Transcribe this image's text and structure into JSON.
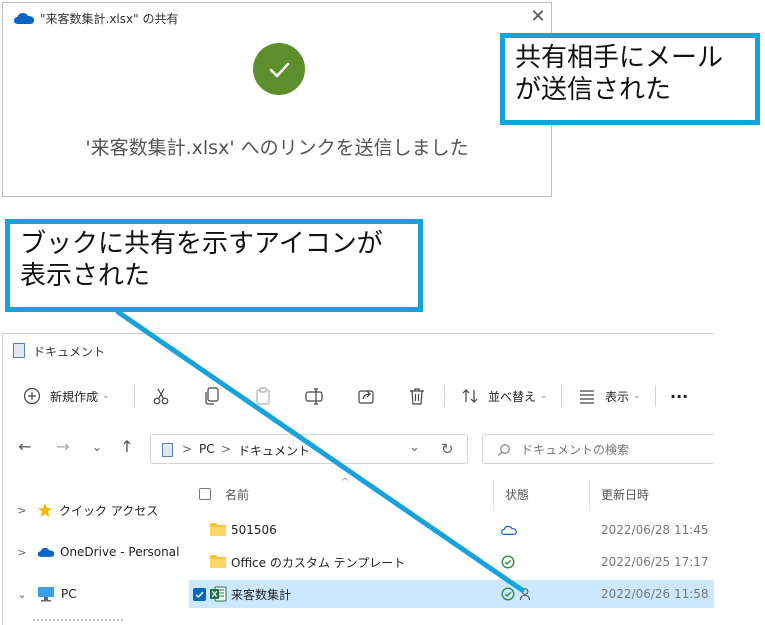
{
  "dialog": {
    "title": "\"来客数集計.xlsx\" の共有",
    "close_glyph": "✕",
    "message": "'来客数集計.xlsx' へのリンクを送信しました"
  },
  "callouts": {
    "top": "共有相手にメール\nが送信された",
    "middle": "ブックに共有を示すアイコンが\n表示された"
  },
  "explorer": {
    "title": "ドキュメント",
    "toolbar": {
      "new_label": "新規作成",
      "sort_label": "並べ替え",
      "view_label": "表示",
      "more_glyph": "···"
    },
    "nav": {
      "back": "←",
      "forward": "→",
      "recent": "⌄",
      "up": "↑",
      "refresh": "↻"
    },
    "address": {
      "pc": "PC",
      "sep": ">",
      "folder": "ドキュメント",
      "dropdown": "⌄"
    },
    "search": {
      "placeholder": "ドキュメントの検索"
    },
    "sidebar": [
      {
        "label": "クイック アクセス",
        "expander": ">",
        "icon": "star-icon"
      },
      {
        "label": "OneDrive - Personal",
        "expander": ">",
        "icon": "cloud-icon"
      },
      {
        "label": "PC",
        "expander": "⌄",
        "icon": "monitor-icon"
      }
    ],
    "columns": {
      "name": "名前",
      "status": "状態",
      "date": "更新日時"
    },
    "files": [
      {
        "name": "501506",
        "type": "folder",
        "status": "cloud-icon",
        "date": "2022/06/28 11:45"
      },
      {
        "name": "Office のカスタム テンプレート",
        "type": "folder",
        "status": "synced-icon",
        "date": "2022/06/25 17:17"
      },
      {
        "name": "来客数集計",
        "type": "excel",
        "status": "shared-icon",
        "date": "2022/06/26 11:58",
        "selected": true
      }
    ]
  },
  "colors": {
    "callout_border": "#16a3dc",
    "check_green": "#5c8f2c",
    "selection": "#cce8ff",
    "onedrive_blue": "#0a64c8",
    "excel_green": "#1e7145"
  }
}
